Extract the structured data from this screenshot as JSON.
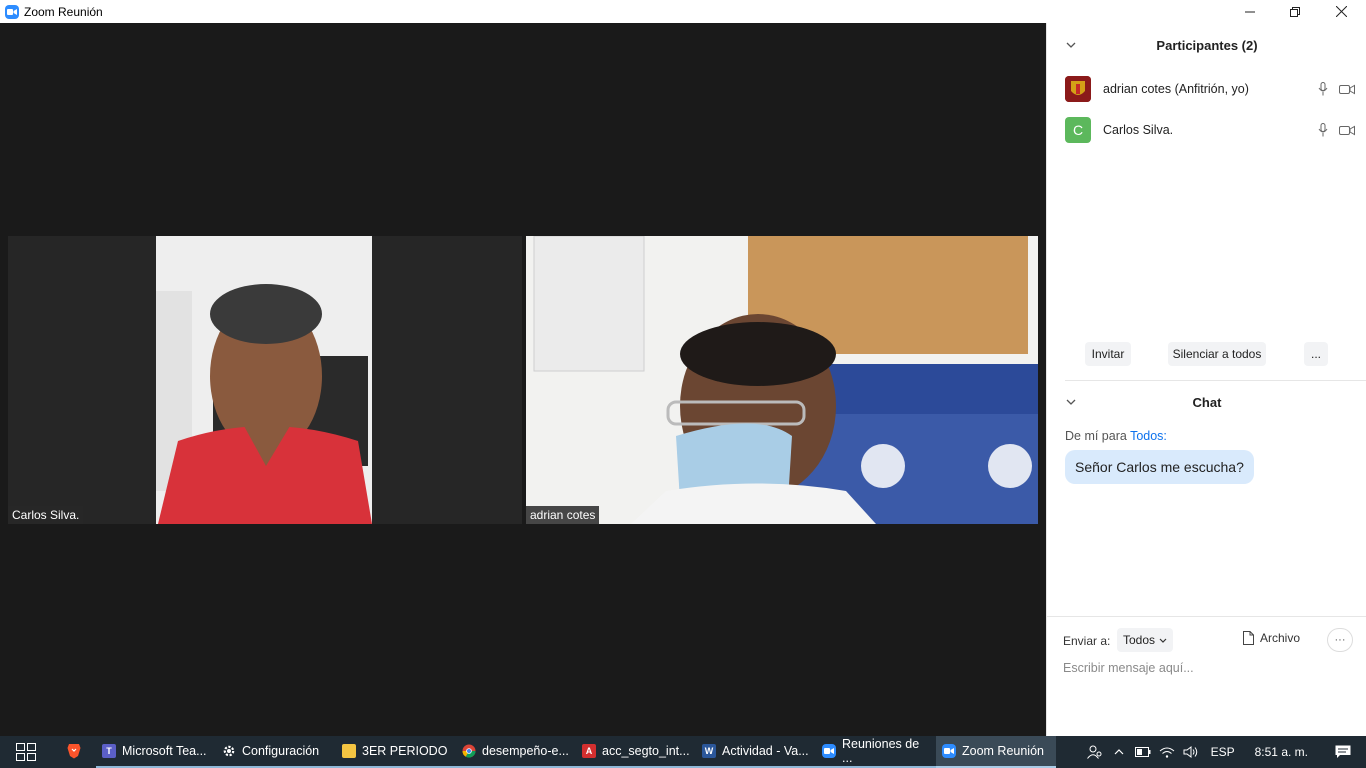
{
  "window": {
    "title": "Zoom Reunión",
    "controls": {
      "minimize": "─",
      "restore": "❐",
      "close": "✕"
    }
  },
  "stage": {
    "tiles": [
      {
        "name": "Carlos Silva."
      },
      {
        "name": "adrian cotes"
      }
    ]
  },
  "participants": {
    "header": "Participantes (2)",
    "items": [
      {
        "name": "adrian cotes (Anfitrión, yo)",
        "avatar_color": "#8b1a1a",
        "avatar_text": ""
      },
      {
        "name": "Carlos Silva.",
        "avatar_color": "#5cb85c",
        "avatar_text": "C"
      }
    ],
    "buttons": {
      "invite": "Invitar",
      "mute_all": "Silenciar a todos",
      "more": "..."
    }
  },
  "chat": {
    "header": "Chat",
    "from_prefix": "De mí para ",
    "to": "Todos:",
    "message": "Señor Carlos me escucha?",
    "send_to_label": "Enviar a:",
    "send_to_value": "Todos",
    "file_label": "Archivo",
    "more": "···",
    "placeholder": "Escribir mensaje aquí..."
  },
  "taskbar": {
    "items": [
      {
        "label": "Microsoft Tea...",
        "icon": "teams-icon",
        "color": "#5b5fc7",
        "glyph": "T",
        "state": "running"
      },
      {
        "label": "Configuración",
        "icon": "gear-icon",
        "color": "#1f2a33",
        "glyph": "⚙",
        "state": "running"
      },
      {
        "label": "3ER PERIODO",
        "icon": "folder-icon",
        "color": "#f4c542",
        "glyph": "",
        "state": "running"
      },
      {
        "label": "desempeño-e...",
        "icon": "chrome-icon",
        "color": "#db4437",
        "glyph": "◎",
        "state": "running"
      },
      {
        "label": "acc_segto_int...",
        "icon": "pdf-icon",
        "color": "#d32f2f",
        "glyph": "A",
        "state": "running"
      },
      {
        "label": "Actividad - Va...",
        "icon": "word-icon",
        "color": "#2b579a",
        "glyph": "W",
        "state": "running"
      },
      {
        "label": "Reuniones de ...",
        "icon": "zoom-icon",
        "color": "#2d8cff",
        "glyph": "▶",
        "state": "running"
      },
      {
        "label": "Zoom Reunión",
        "icon": "zoom-icon",
        "color": "#2d8cff",
        "glyph": "▶",
        "state": "active"
      }
    ],
    "language": "ESP",
    "time": "8:51 a. m."
  }
}
